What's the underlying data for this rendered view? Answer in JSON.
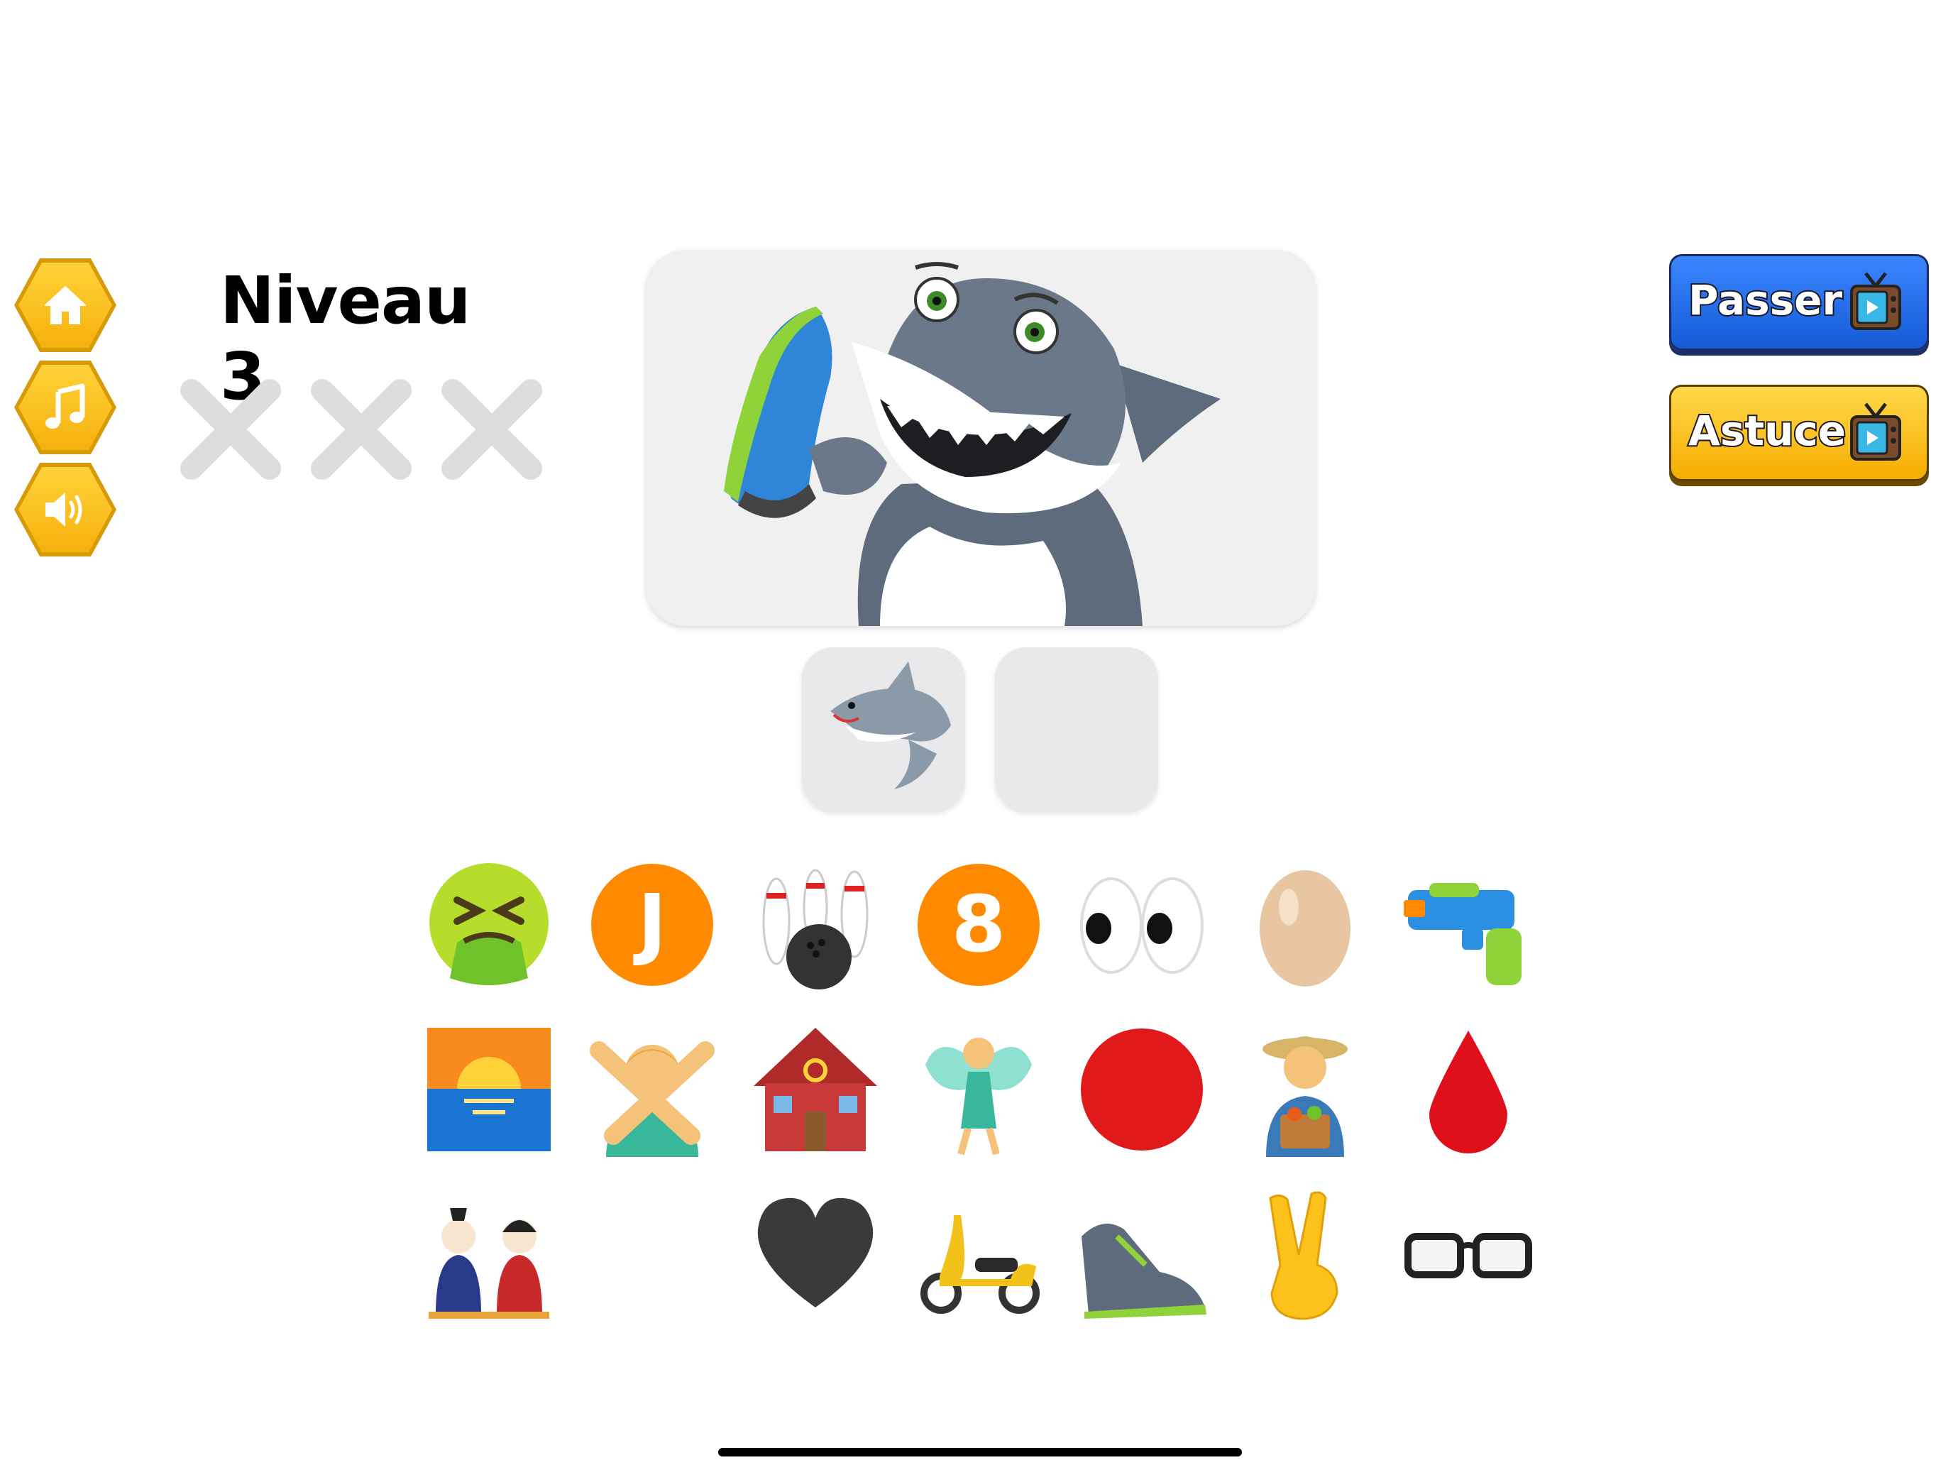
{
  "header": {
    "level_label": "Niveau 3"
  },
  "menu": {
    "icons": [
      "home-icon",
      "music-note-icon",
      "speaker-icon"
    ],
    "accent": "#f6b10c"
  },
  "lives": {
    "total": 3,
    "used": 0,
    "mark": "cross-icon",
    "color": "#dddddd"
  },
  "actions": {
    "skip": {
      "label": "Passer",
      "color": "#1e6cf0",
      "icon": "tv-icon"
    },
    "hint": {
      "label": "Astuce",
      "color": "#ffc21a",
      "icon": "tv-icon"
    }
  },
  "puzzle": {
    "image": "shark-holding-sneaker",
    "answer_slots": [
      "shark-emoji",
      ""
    ]
  },
  "choices": [
    "vomiting-face-emoji",
    "letter-j-emoji",
    "bowling-emoji",
    "number-8-emoji",
    "eyes-emoji",
    "egg-emoji",
    "water-pistol-emoji",
    "sunrise-emoji",
    "person-gesturing-no-emoji",
    "post-office-emoji",
    "fairy-emoji",
    "red-circle-emoji",
    "farmer-emoji",
    "drop-of-blood-emoji",
    "dolls-emoji",
    "",
    "black-heart-emoji",
    "scooter-emoji",
    "running-shoe-emoji",
    "victory-hand-emoji",
    "glasses-emoji"
  ],
  "choice_letters": {
    "letter-j-emoji": "J",
    "number-8-emoji": "8"
  }
}
